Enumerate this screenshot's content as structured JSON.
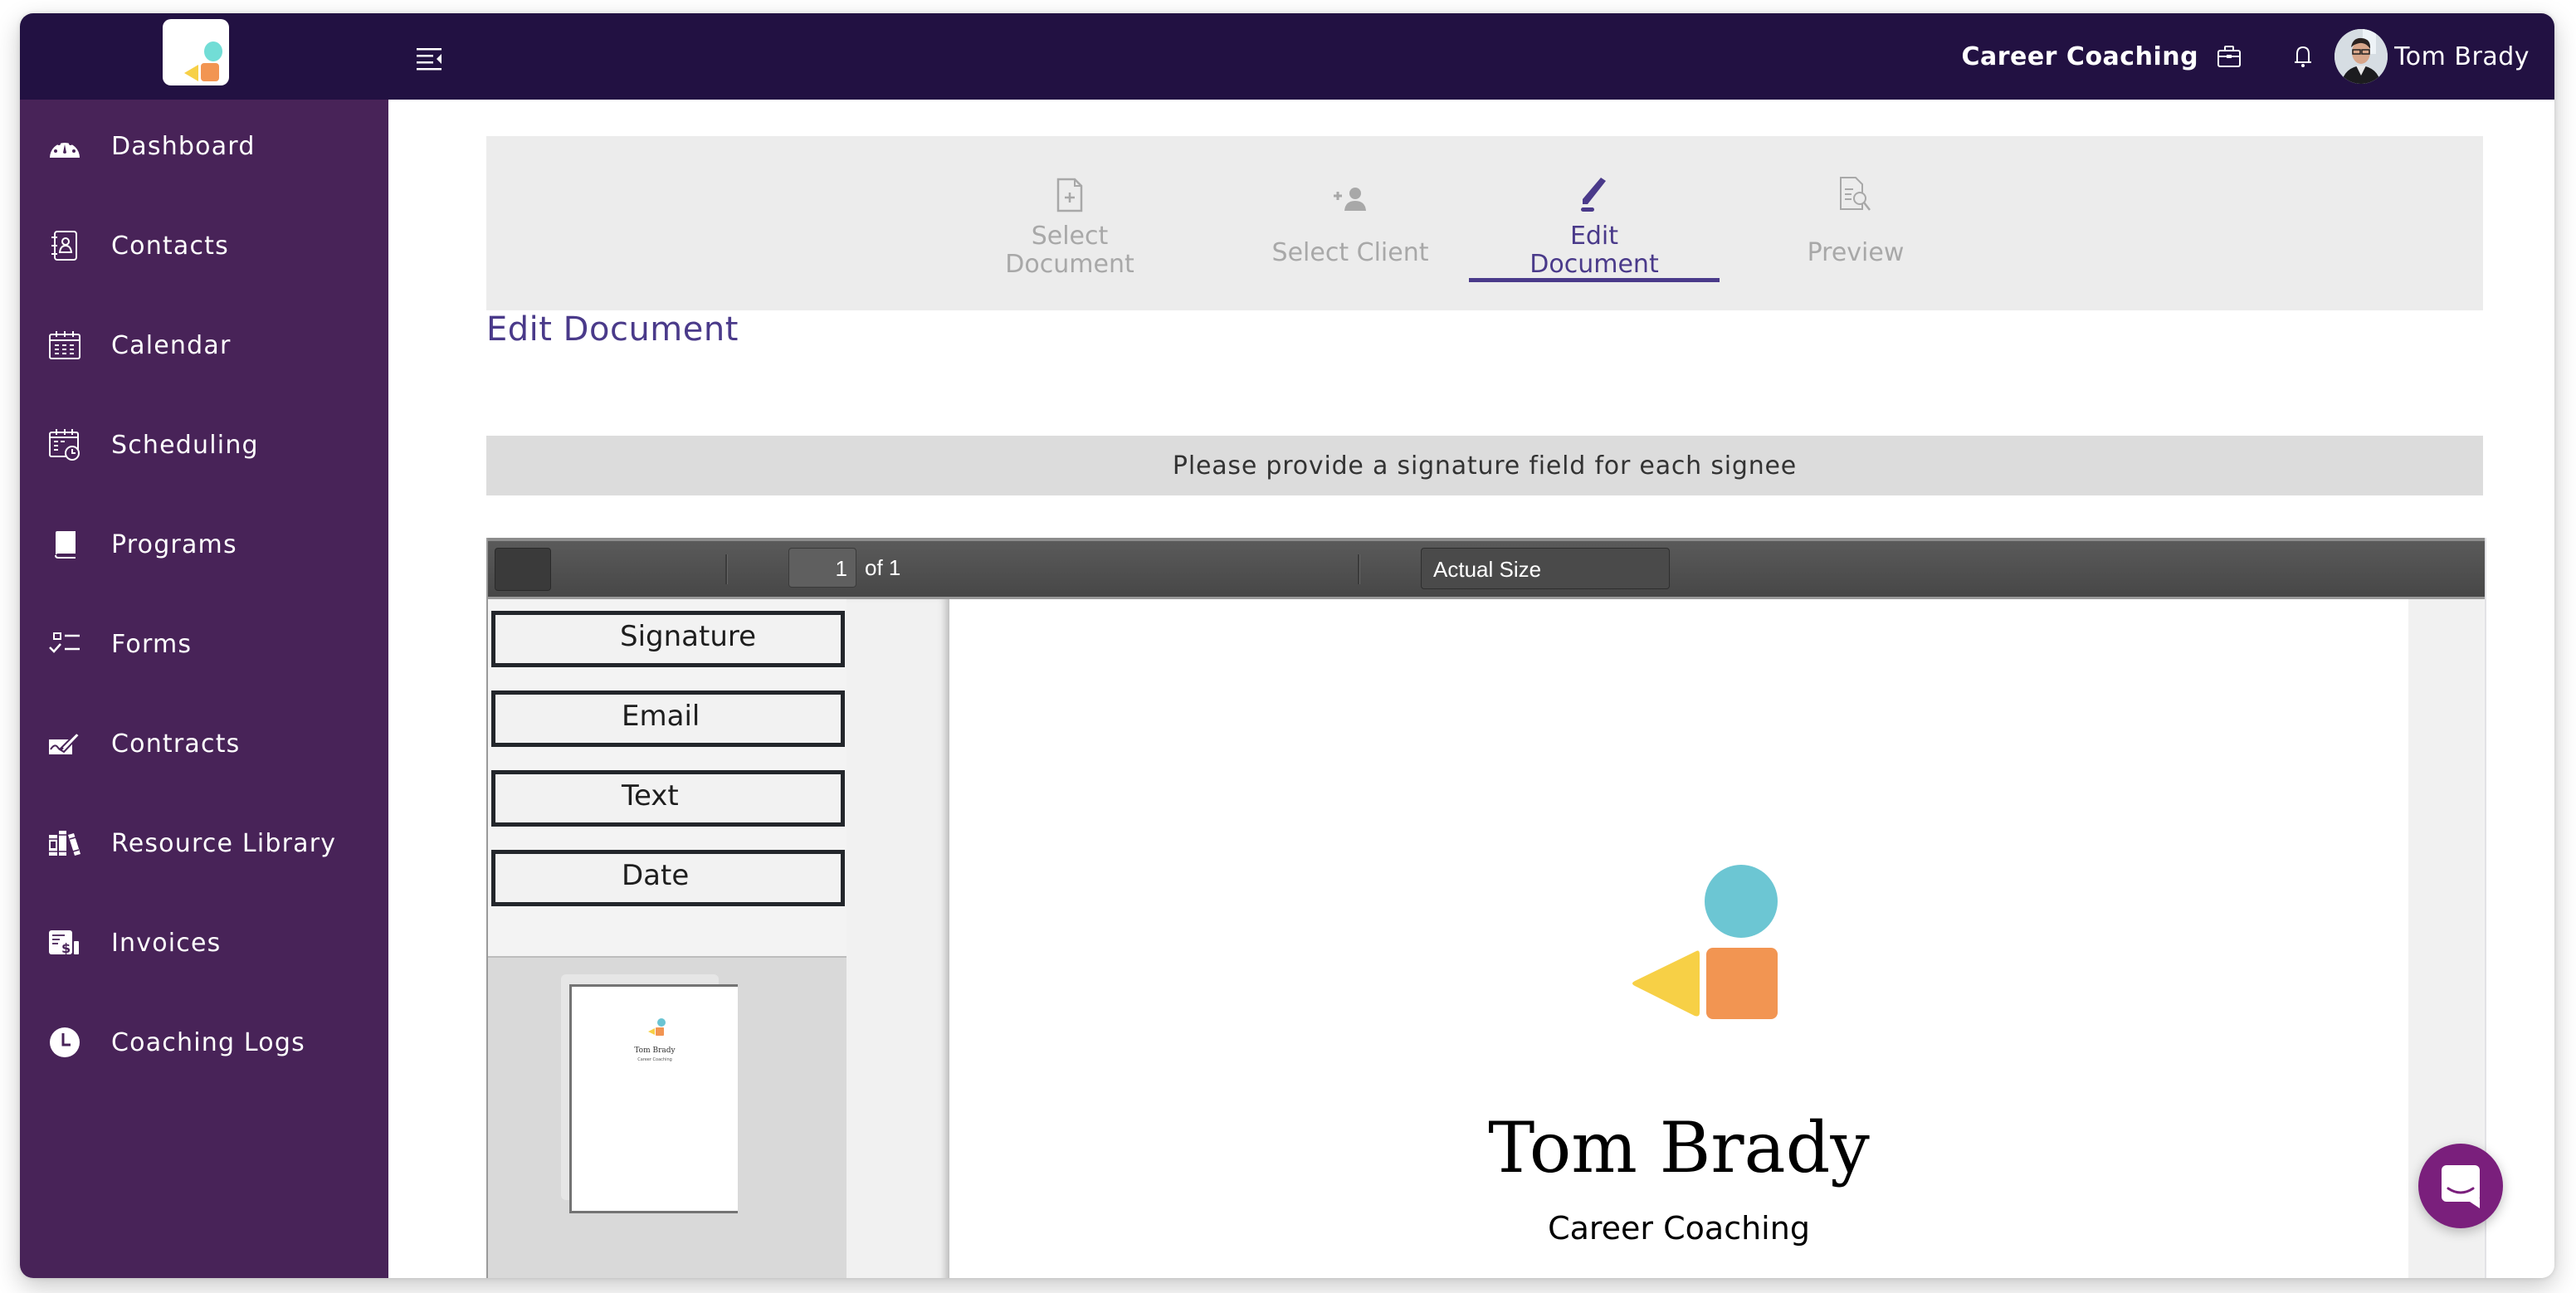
{
  "header": {
    "organization": "Career Coaching",
    "user_name": "Tom Brady",
    "icons": {
      "logo": "app-logo",
      "menu_toggle": "menu-collapse-icon",
      "organization": "briefcase-icon",
      "notifications": "bell-icon",
      "avatar": "user-avatar"
    }
  },
  "sidebar": {
    "items": [
      {
        "label": "Dashboard",
        "icon": "dashboard-gauge-icon"
      },
      {
        "label": "Contacts",
        "icon": "contacts-book-icon"
      },
      {
        "label": "Calendar",
        "icon": "calendar-icon"
      },
      {
        "label": "Scheduling",
        "icon": "calendar-clock-icon"
      },
      {
        "label": "Programs",
        "icon": "book-icon"
      },
      {
        "label": "Forms",
        "icon": "checklist-icon"
      },
      {
        "label": "Contracts",
        "icon": "signature-pen-icon"
      },
      {
        "label": "Resource Library",
        "icon": "library-books-icon"
      },
      {
        "label": "Invoices",
        "icon": "invoice-dollar-icon"
      },
      {
        "label": "Coaching Logs",
        "icon": "clock-icon"
      }
    ]
  },
  "steps": [
    {
      "label_line1": "Select",
      "label_line2": "Document",
      "icon": "file-plus-icon",
      "state": "inactive"
    },
    {
      "label_line1": "Select Client",
      "label_line2": "",
      "icon": "user-plus-icon",
      "state": "inactive"
    },
    {
      "label_line1": "Edit",
      "label_line2": "Document",
      "icon": "pencil-icon",
      "state": "active"
    },
    {
      "label_line1": "Preview",
      "label_line2": "",
      "icon": "document-search-icon",
      "state": "inactive"
    }
  ],
  "page": {
    "title": "Edit Document",
    "notice": "Please provide a signature field for each signee"
  },
  "viewer": {
    "current_page": "1",
    "page_count_label": "of 1",
    "zoom_option": "Actual Size",
    "field_buttons": [
      "Signature",
      "Email",
      "Text",
      "Date"
    ],
    "thumbnail": {
      "name": "Tom Brady",
      "subtitle": "Career Coaching"
    },
    "document": {
      "name": "Tom Brady",
      "subtitle": "Career Coaching"
    }
  },
  "chat": {
    "icon": "chat-bubble-icon"
  },
  "colors": {
    "header_bg": "#221142",
    "sidebar_bg": "#482358",
    "accent": "#4a3a8a",
    "chat_button": "#7a1f7c",
    "logo_circle": "#6cc6d3",
    "logo_square": "#f29552",
    "logo_triangle": "#f7d046"
  }
}
